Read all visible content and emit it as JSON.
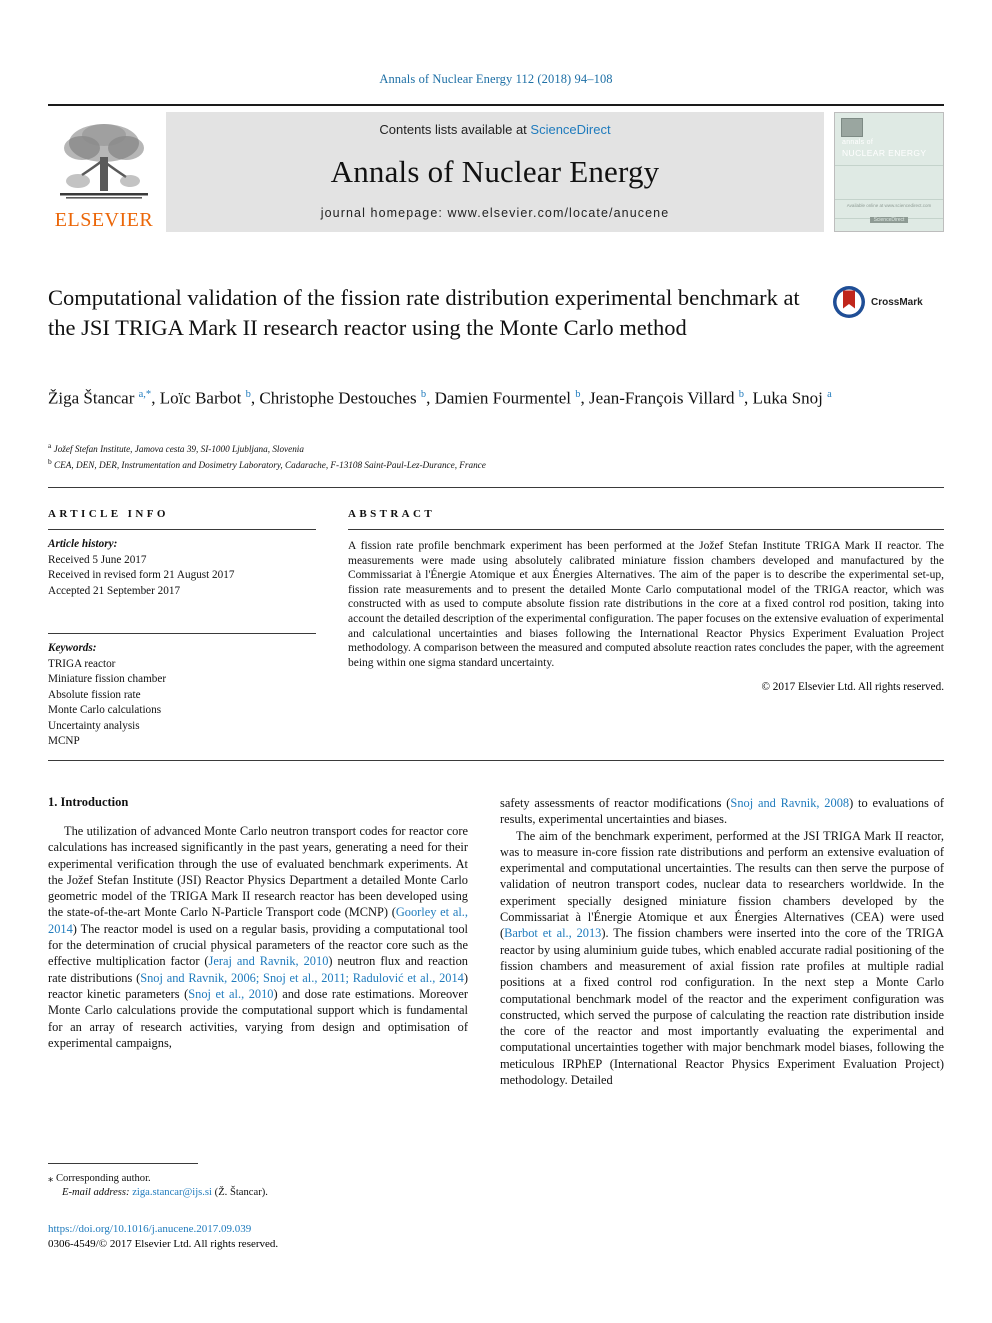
{
  "running_head": "Annals of Nuclear Energy 112 (2018) 94–108",
  "masthead": {
    "publisher_name": "ELSEVIER",
    "contents_prefix": "Contents lists available at ",
    "sciencedirect": "ScienceDirect",
    "journal_name": "Annals of Nuclear Energy",
    "homepage": "journal homepage: www.elsevier.com/locate/anucene",
    "cover": {
      "line1": "annals of",
      "line2": "NUCLEAR ENERGY",
      "footer_a": "Available online at www.sciencedirect.com",
      "footer_b": "ScienceDirect"
    }
  },
  "article": {
    "title": "Computational validation of the fission rate distribution experimental benchmark at the JSI TRIGA Mark II research reactor using the Monte Carlo method",
    "crossmark_label": "CrossMark",
    "authors_html": "Žiga Štancar <sup>a,*</sup>, Loïc Barbot <sup>b</sup>, Christophe Destouches <sup>b</sup>, Damien Fourmentel <sup>b</sup>, Jean-François Villard <sup>b</sup>, Luka Snoj <sup>a</sup>",
    "affiliation_a": "Jožef Stefan Institute, Jamova cesta 39, SI-1000 Ljubljana, Slovenia",
    "affiliation_b": "CEA, DEN, DER, Instrumentation and Dosimetry Laboratory, Cadarache, F-13108 Saint-Paul-Lez-Durance, France"
  },
  "article_info": {
    "heading": "ARTICLE INFO",
    "history_label": "Article history:",
    "history": [
      "Received 5 June 2017",
      "Received in revised form 21 August 2017",
      "Accepted 21 September 2017"
    ],
    "keywords_label": "Keywords:",
    "keywords": [
      "TRIGA reactor",
      "Miniature fission chamber",
      "Absolute fission rate",
      "Monte Carlo calculations",
      "Uncertainty analysis",
      "MCNP"
    ]
  },
  "abstract": {
    "heading": "ABSTRACT",
    "text": "A fission rate profile benchmark experiment has been performed at the Jožef Stefan Institute TRIGA Mark II reactor. The measurements were made using absolutely calibrated miniature fission chambers developed and manufactured by the Commissariat à l'Énergie Atomique et aux Énergies Alternatives. The aim of the paper is to describe the experimental set-up, fission rate measurements and to present the detailed Monte Carlo computational model of the TRIGA reactor, which was constructed with as used to compute absolute fission rate distributions in the core at a fixed control rod position, taking into account the detailed description of the experimental configuration. The paper focuses on the extensive evaluation of experimental and calculational uncertainties and biases following the International Reactor Physics Experiment Evaluation Project methodology. A comparison between the measured and computed absolute reaction rates concludes the paper, with the agreement being within one sigma standard uncertainty.",
    "copyright": "© 2017 Elsevier Ltd. All rights reserved."
  },
  "introduction": {
    "heading": "1. Introduction",
    "left_paragraph_html": "The utilization of advanced Monte Carlo neutron transport codes for reactor core calculations has increased significantly in the past years, generating a need for their experimental verification through the use of evaluated benchmark experiments. At the Jožef Stefan Institute (JSI) Reactor Physics Department a detailed Monte Carlo geometric model of the TRIGA Mark II research reactor has been developed using the state-of-the-art Monte Carlo N-Particle Transport code (MCNP) (<span class=\"cit\">Goorley et al., 2014</span>) The reactor model is used on a regular basis, providing a computational tool for the determination of crucial physical parameters of the reactor core such as the effective multiplication factor (<span class=\"cit\">Jeraj and Ravnik, 2010</span>) neutron flux and reaction rate distributions (<span class=\"cit\">Snoj and Ravnik, 2006; Snoj et al., 2011; Radulović et al., 2014</span>) reactor kinetic parameters (<span class=\"cit\">Snoj et al., 2010</span>) and dose rate estimations. Moreover Monte Carlo calculations provide the computational support which is fundamental for an array of research activities, varying from design and optimisation of experimental campaigns,",
    "right_paragraph1_html": "safety assessments of reactor modifications (<span class=\"cit\">Snoj and Ravnik, 2008</span>) to evaluations of results, experimental uncertainties and biases.",
    "right_paragraph2_html": "The aim of the benchmark experiment, performed at the JSI TRIGA Mark II reactor, was to measure in-core fission rate distributions and perform an extensive evaluation of experimental and computational uncertainties. The results can then serve the purpose of validation of neutron transport codes, nuclear data to researchers worldwide. In the experiment specially designed miniature fission chambers developed by the Commissariat à l'Énergie Atomique et aux Énergies Alternatives (CEA) were used (<span class=\"cit\">Barbot et al., 2013</span>). The fission chambers were inserted into the core of the TRIGA reactor by using aluminium guide tubes, which enabled accurate radial positioning of the fission chambers and measurement of axial fission rate profiles at multiple radial positions at a fixed control rod configuration. In the next step a Monte Carlo computational benchmark model of the reactor and the experiment configuration was constructed, which served the purpose of calculating the reaction rate distribution inside the core of the reactor and most importantly evaluating the experimental and computational uncertainties together with major benchmark model biases, following the meticulous IRPhEP (International Reactor Physics Experiment Evaluation Project) methodology. Detailed"
  },
  "footer": {
    "corresponding_marker": "⁎",
    "corresponding_label": "Corresponding author.",
    "email_label": "E-mail address:",
    "email": "ziga.stancar@ijs.si",
    "email_suffix": "(Ž. Štancar).",
    "doi": "https://doi.org/10.1016/j.anucene.2017.09.039",
    "issn_line": "0306-4549/© 2017 Elsevier Ltd. All rights reserved."
  },
  "colors": {
    "link_blue": "#1f7bbd",
    "elsevier_orange": "#eb6608",
    "masthead_grey": "#e3e3e3",
    "cover_green": "#dfeae4"
  }
}
